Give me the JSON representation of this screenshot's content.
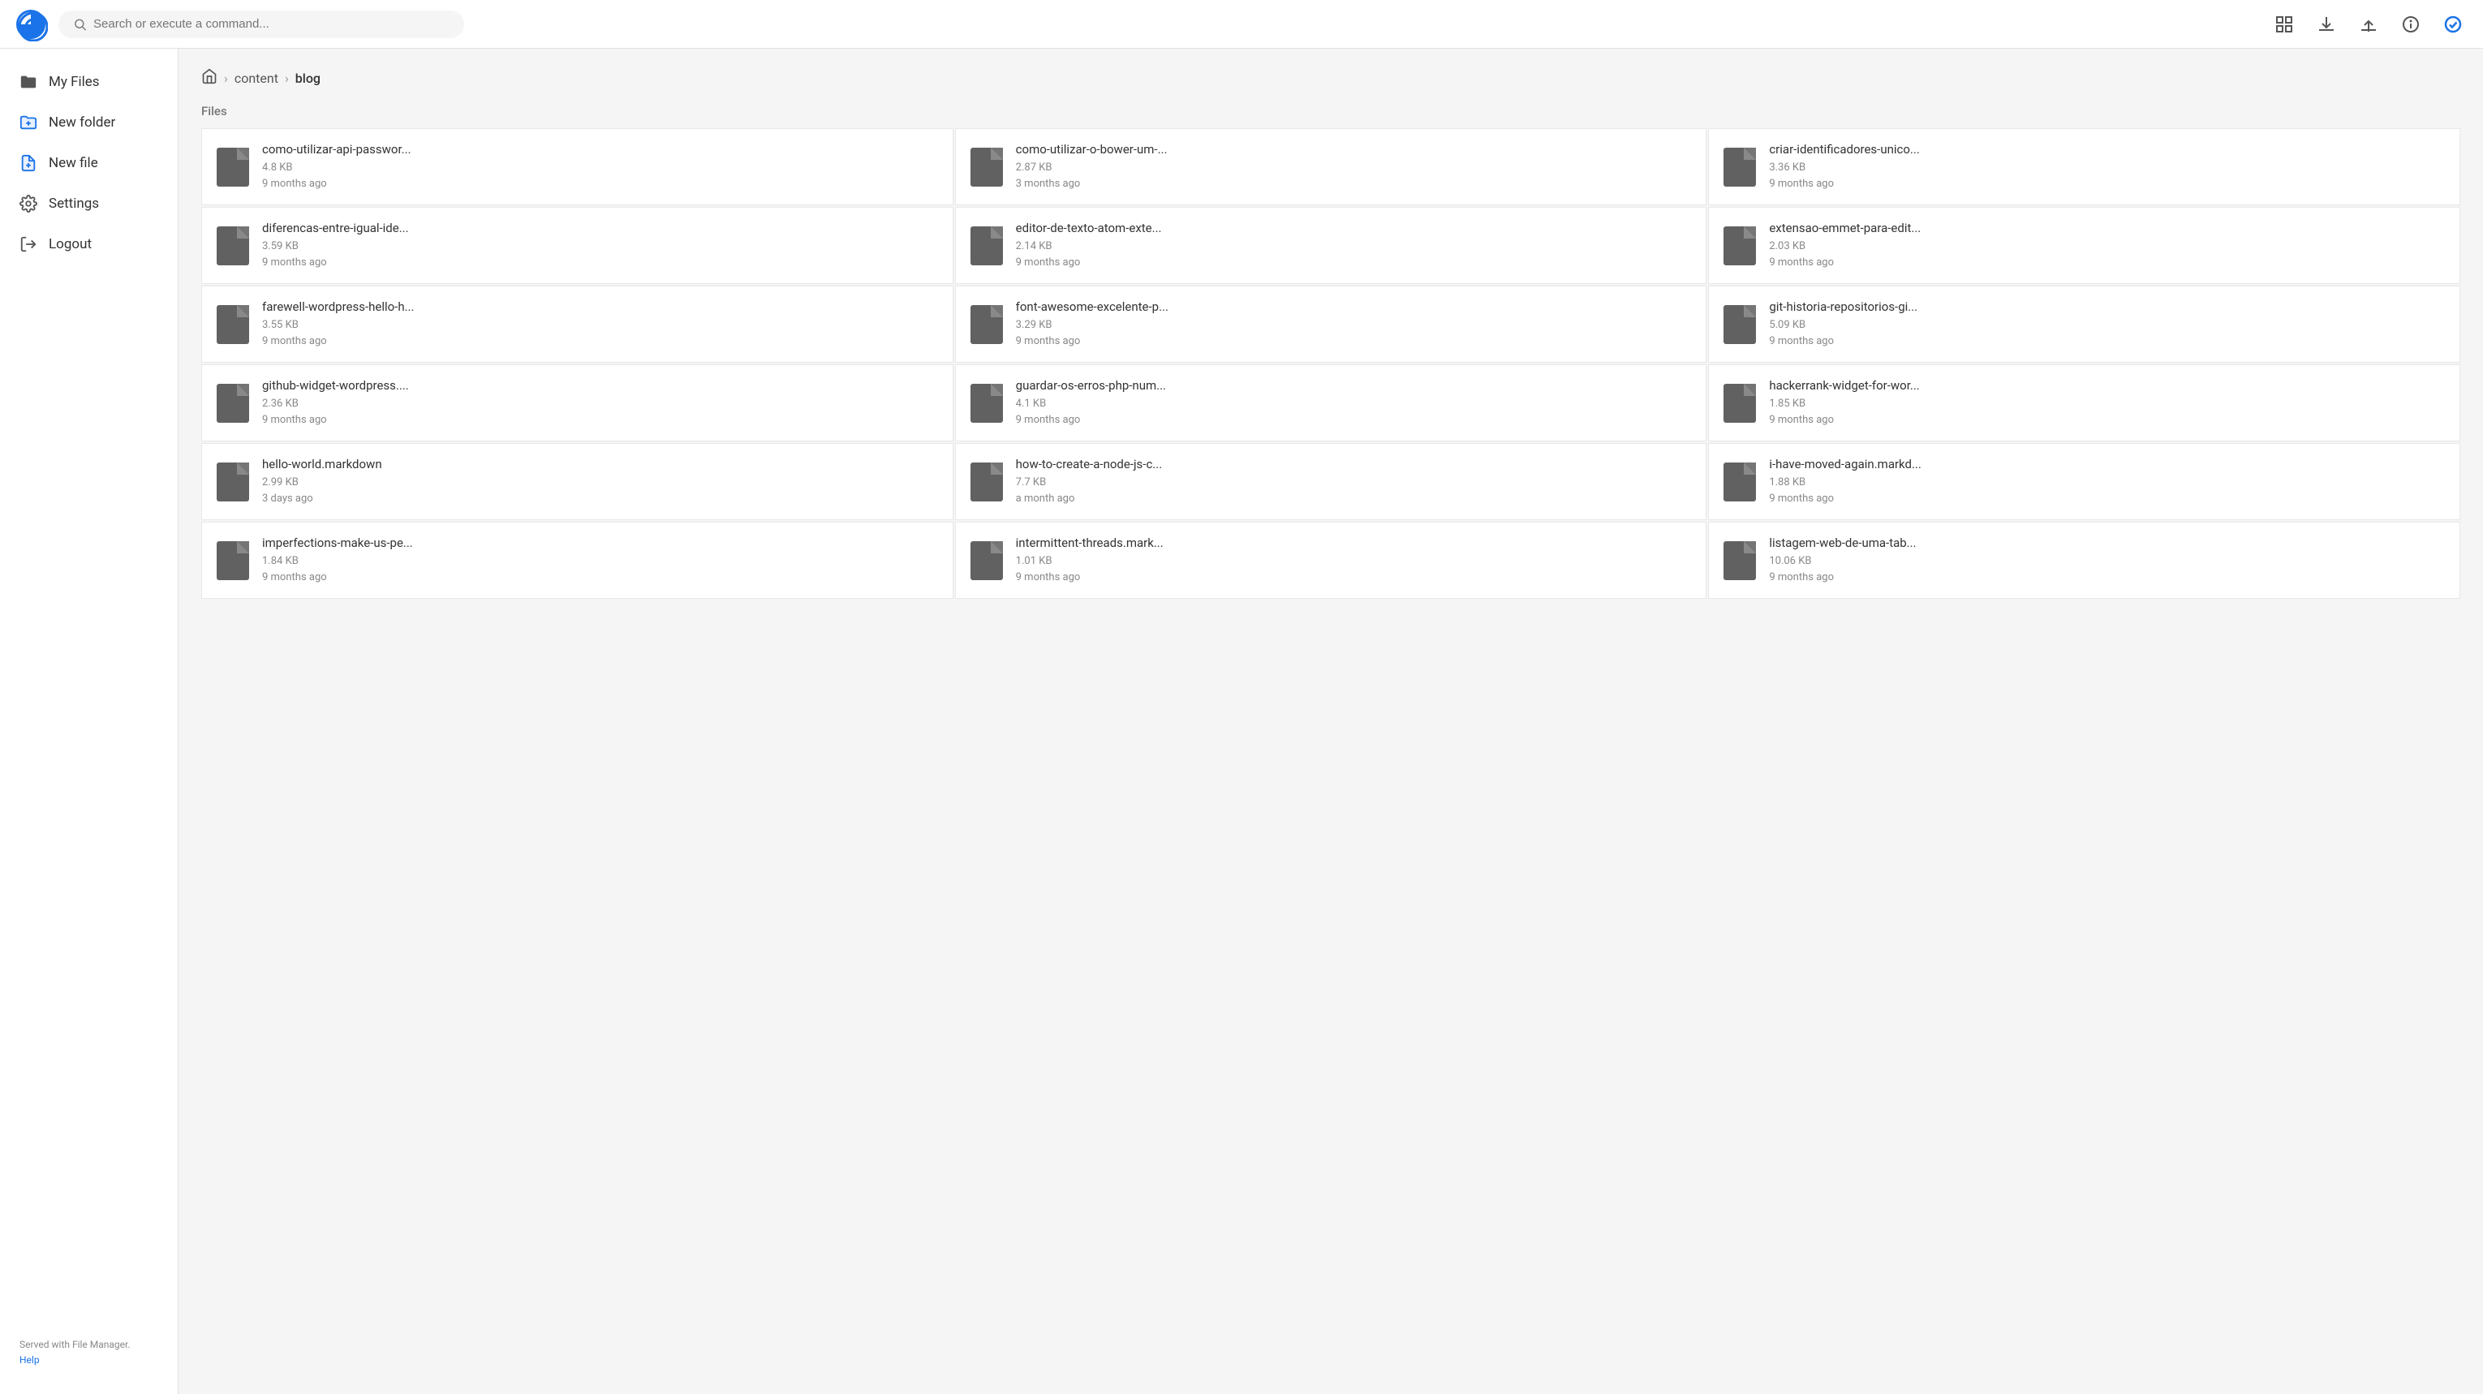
{
  "topbar": {
    "search_placeholder": "Search or execute a command...",
    "logo_alt": "File Manager Logo"
  },
  "topbar_icons": [
    {
      "name": "list-view-icon",
      "label": "List View"
    },
    {
      "name": "download-icon",
      "label": "Download"
    },
    {
      "name": "upload-icon",
      "label": "Upload"
    },
    {
      "name": "info-icon",
      "label": "Info"
    },
    {
      "name": "check-icon",
      "label": "Done"
    }
  ],
  "sidebar": {
    "items": [
      {
        "id": "my-files",
        "label": "My Files",
        "icon": "folder-icon"
      },
      {
        "id": "new-folder",
        "label": "New folder",
        "icon": "add-folder-icon"
      },
      {
        "id": "new-file",
        "label": "New file",
        "icon": "add-file-icon"
      },
      {
        "id": "settings",
        "label": "Settings",
        "icon": "gear-icon"
      },
      {
        "id": "logout",
        "label": "Logout",
        "icon": "logout-icon"
      }
    ],
    "footer_text": "Served with File Manager.",
    "footer_link": "Help"
  },
  "breadcrumb": {
    "home": "home",
    "separator": ">",
    "parts": [
      "content",
      "blog"
    ]
  },
  "section_label": "Files",
  "files": [
    {
      "name": "como-utilizar-api-passwor...",
      "size": "4.8 KB",
      "modified": "9 months ago"
    },
    {
      "name": "como-utilizar-o-bower-um-...",
      "size": "2.87 KB",
      "modified": "3 months ago"
    },
    {
      "name": "criar-identificadores-unico...",
      "size": "3.36 KB",
      "modified": "9 months ago"
    },
    {
      "name": "diferencas-entre-igual-ide...",
      "size": "3.59 KB",
      "modified": "9 months ago"
    },
    {
      "name": "editor-de-texto-atom-exte...",
      "size": "2.14 KB",
      "modified": "9 months ago"
    },
    {
      "name": "extensao-emmet-para-edit...",
      "size": "2.03 KB",
      "modified": "9 months ago"
    },
    {
      "name": "farewell-wordpress-hello-h...",
      "size": "3.55 KB",
      "modified": "9 months ago"
    },
    {
      "name": "font-awesome-excelente-p...",
      "size": "3.29 KB",
      "modified": "9 months ago"
    },
    {
      "name": "git-historia-repositorios-gi...",
      "size": "5.09 KB",
      "modified": "9 months ago"
    },
    {
      "name": "github-widget-wordpress....",
      "size": "2.36 KB",
      "modified": "9 months ago"
    },
    {
      "name": "guardar-os-erros-php-num...",
      "size": "4.1 KB",
      "modified": "9 months ago"
    },
    {
      "name": "hackerrank-widget-for-wor...",
      "size": "1.85 KB",
      "modified": "9 months ago"
    },
    {
      "name": "hello-world.markdown",
      "size": "2.99 KB",
      "modified": "3 days ago"
    },
    {
      "name": "how-to-create-a-node-js-c...",
      "size": "7.7 KB",
      "modified": "a month ago"
    },
    {
      "name": "i-have-moved-again.markd...",
      "size": "1.88 KB",
      "modified": "9 months ago"
    },
    {
      "name": "imperfections-make-us-pe...",
      "size": "1.84 KB",
      "modified": "9 months ago"
    },
    {
      "name": "intermittent-threads.mark...",
      "size": "1.01 KB",
      "modified": "9 months ago"
    },
    {
      "name": "listagem-web-de-uma-tab...",
      "size": "10.06 KB",
      "modified": "9 months ago"
    }
  ]
}
